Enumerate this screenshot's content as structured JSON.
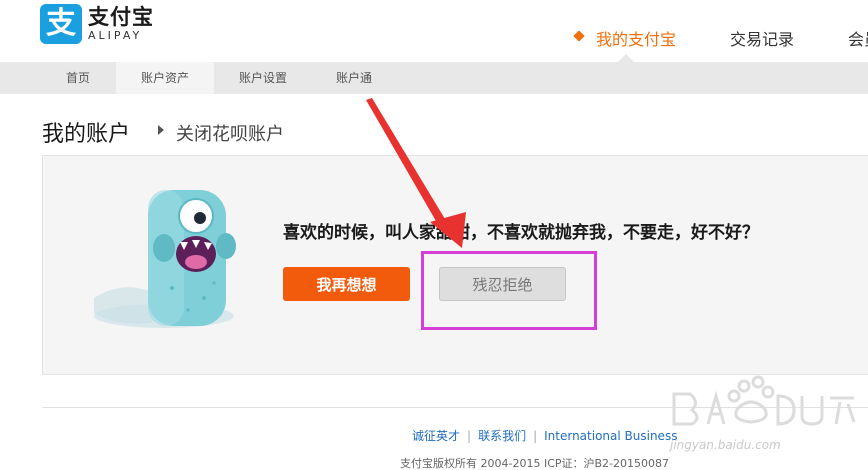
{
  "logo": {
    "cn": "支付宝",
    "en": "ALIPAY",
    "mark": "支"
  },
  "topnav": {
    "items": [
      {
        "label": "我的支付宝"
      },
      {
        "label": "交易记录"
      },
      {
        "label": "会员"
      }
    ],
    "active_index": 0
  },
  "subnav": {
    "items": [
      {
        "label": "首页"
      },
      {
        "label": "账户资产"
      },
      {
        "label": "账户设置"
      },
      {
        "label": "账户通"
      }
    ],
    "active_index": 1
  },
  "page": {
    "title": "我的账户",
    "breadcrumb": "关闭花呗账户"
  },
  "dialog": {
    "message": "喜欢的时候，叫人家甜甜，不喜欢就抛弃我，不要走，好不好？",
    "confirm_label": "我再想想",
    "refuse_label": "残忍拒绝"
  },
  "footer": {
    "links": [
      {
        "label": "诚征英才"
      },
      {
        "label": "联系我们"
      },
      {
        "label": "International Business"
      }
    ],
    "copyright": "支付宝版权所有 2004-2015 ICP证：沪B2-20150087"
  },
  "watermark": {
    "text": "jingyan.baidu.com"
  },
  "colors": {
    "brand_blue": "#1aa0e0",
    "accent_orange": "#f2700c",
    "button_orange": "#f25a0c",
    "highlight_magenta": "#d63fd6",
    "arrow_red": "#e8322f",
    "link_blue": "#1f6ebf"
  }
}
